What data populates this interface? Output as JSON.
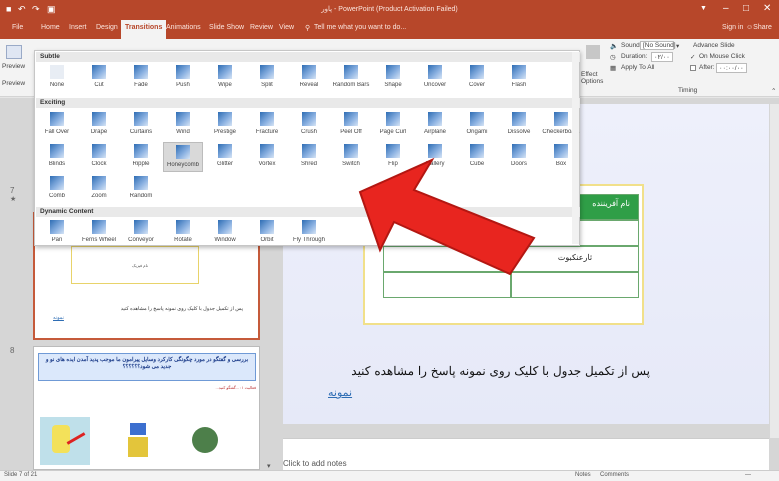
{
  "titlebar": {
    "title": "پاور - PowerPoint (Product Activation Failed)",
    "quick_access": [
      "■",
      "↶",
      "↷",
      "▣"
    ],
    "window_buttons": [
      "▼",
      "–",
      "□",
      "✕"
    ]
  },
  "tabs": {
    "file": "File",
    "home": "Home",
    "insert": "Insert",
    "design": "Design",
    "transitions": "Transitions",
    "animations": "Animations",
    "slideshow": "Slide Show",
    "review": "Review",
    "view": "View",
    "tellme": "Tell me what you want to do...",
    "signin": "Sign in",
    "share": "Share"
  },
  "ribbon": {
    "preview": "Preview",
    "preview_group": "Preview",
    "effect_options": "Effect Options",
    "sound_label": "Sound:",
    "sound_value": "[No Sound]",
    "duration_label": "Duration:",
    "duration_value": "۰۲/۰۰",
    "apply_all": "Apply To All",
    "advance_slide": "Advance Slide",
    "on_mouse_click": "On Mouse Click",
    "after_label": "After:",
    "after_value": "۰۰:۰۰/۰۰",
    "timing_group": "Timing"
  },
  "gallery": {
    "subtle_title": "Subtle",
    "exciting_title": "Exciting",
    "dynamic_title": "Dynamic Content",
    "subtle": [
      "None",
      "Cut",
      "Fade",
      "Push",
      "Wipe",
      "Split",
      "Reveal",
      "Random Bars",
      "Shape",
      "Uncover",
      "Cover",
      "Flash"
    ],
    "exciting_row1": [
      "Fall Over",
      "Drape",
      "Curtains",
      "Wind",
      "Prestige",
      "Fracture",
      "Crush",
      "Peel Off",
      "Page Curl",
      "Airplane",
      "Origami",
      "Dissolve",
      "Checkerboa..."
    ],
    "exciting_row2": [
      "Blinds",
      "Clock",
      "Ripple",
      "Honeycomb",
      "Glitter",
      "Vortex",
      "Shred",
      "Switch",
      "Flip",
      "Gallery",
      "Cube",
      "Doors",
      "Box"
    ],
    "exciting_row3": [
      "Comb",
      "Zoom",
      "Random"
    ],
    "dynamic": [
      "Pan",
      "Ferris Wheel",
      "Conveyor",
      "Rotate",
      "Window",
      "Orbit",
      "Fly Through"
    ],
    "colors": {
      "accent": "#2e6db4",
      "selected_bg": "#d9d9d9"
    }
  },
  "slides": {
    "s7_caption": "پس از تکمیل جدول با کلیک روی نمونه پاسخ را مشاهده کنید",
    "s7_link": "نمونه",
    "s7_table_text": "نام فیزیک",
    "s8_number": "8",
    "s8_title": "بررسی و گفتگو در مورد چگونگی کارکرد وسایل پیرامون ما موجب پدید آمدن ایده های نو و جدید می شود؟؟؟؟؟؟",
    "s8_body": "فعالیت ۱: ...گفتگو کنید..."
  },
  "main": {
    "table_header": "نام آفریننده",
    "table_cell": "ثارعنکبوت",
    "caption": "پس از تکمیل جدول با کلیک روی نمونه پاسخ را مشاهده کنید",
    "link": "نمونه",
    "notes_placeholder": "Click to add notes"
  },
  "status": {
    "left": "Slide 7 of 21",
    "notes": "Notes",
    "comments": "Comments",
    "zoom": "—"
  }
}
